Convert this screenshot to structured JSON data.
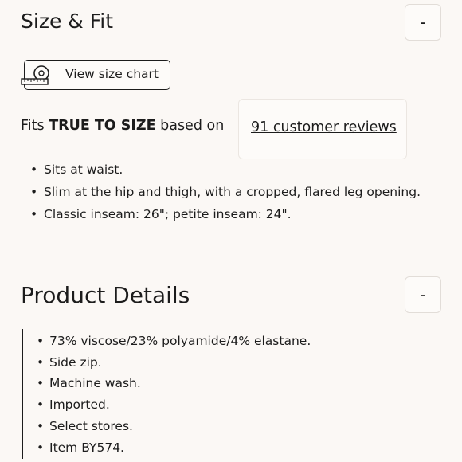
{
  "size_fit": {
    "title": "Size & Fit",
    "toggle_label": "-",
    "size_chart_label": "View size chart",
    "fits_prefix": "Fits ",
    "fits_strong": "TRUE TO SIZE",
    "fits_suffix": " based on",
    "reviews_link": "91 customer reviews",
    "bullets": [
      "Sits at waist.",
      "Slim at the hip and thigh, with a cropped, flared leg opening.",
      "Classic inseam: 26\"; petite inseam: 24\"."
    ]
  },
  "product_details": {
    "title": "Product Details",
    "toggle_label": "-",
    "bullets": [
      "73% viscose/23% polyamide/4% elastane.",
      "Side zip.",
      "Machine wash.",
      "Imported.",
      "Select stores.",
      "Item BY574."
    ]
  },
  "icons": {
    "size_chart": "measuring-tape-icon"
  },
  "colors": {
    "background": "#fbf8f5",
    "text": "#1c1c1c",
    "border": "#e2ddd8"
  }
}
